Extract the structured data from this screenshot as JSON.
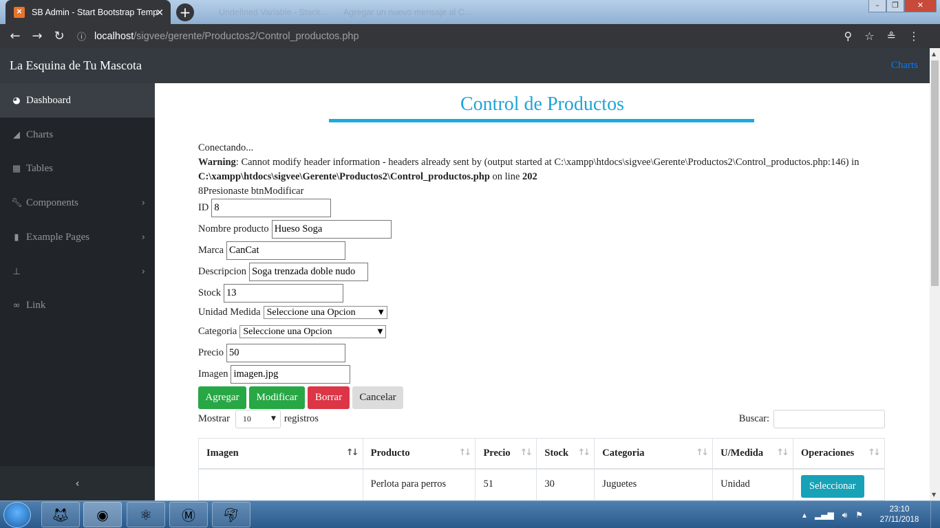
{
  "browser": {
    "active_tab": {
      "title": "SB Admin - Start Bootstrap Temp",
      "favicon": "xampp-favicon-icon"
    },
    "inactive_tabs": [
      {
        "title": "Undefined Variable - Stack..."
      },
      {
        "title": "Agregar un nuevo mensaje al C..."
      }
    ],
    "url_host": "localhost",
    "url_path": "/sigvee/gerente/Productos2/Control_productos.php",
    "icons": [
      "back-icon",
      "forward-icon",
      "reload-icon",
      "info-icon",
      "zoom-icon",
      "star-icon",
      "extension-icon",
      "menu-icon"
    ]
  },
  "navbar": {
    "brand": "La Esquina de Tu Mascota",
    "link": "Charts"
  },
  "sidebar": {
    "items": [
      {
        "label": "Dashboard",
        "icon": "dashboard-icon",
        "active": true
      },
      {
        "label": "Charts",
        "icon": "area-chart-icon"
      },
      {
        "label": "Tables",
        "icon": "table-icon"
      },
      {
        "label": "Components",
        "icon": "wrench-icon",
        "has_children": true
      },
      {
        "label": "Example Pages",
        "icon": "file-icon",
        "has_children": true
      },
      {
        "label": "",
        "icon": "sitemap-icon",
        "has_children": true
      },
      {
        "label": "Link",
        "icon": "link-icon"
      }
    ],
    "toggle": "‹"
  },
  "page": {
    "title": "Control de Productos",
    "connecting": "Conectando...",
    "warning_label": "Warning",
    "warning_text": ": Cannot modify header information - headers already sent by (output started at C:\\xampp\\htdocs\\sigvee\\Gerente\\Productos2\\Control_productos.php:146) in",
    "warning_file": "C:\\xampp\\htdocs\\sigvee\\Gerente\\Productos2\\Control_productos.php",
    "warning_online": " on line ",
    "warning_line": "202",
    "pressed": "8Presionaste btnModificar"
  },
  "form": {
    "id": {
      "label": "ID",
      "value": "8"
    },
    "nombre": {
      "label": "Nombre producto",
      "value": "Hueso Soga"
    },
    "marca": {
      "label": "Marca",
      "value": "CanCat"
    },
    "descripcion": {
      "label": "Descripcion",
      "value": "Soga trenzada doble nudo"
    },
    "stock": {
      "label": "Stock",
      "value": "13"
    },
    "unidad": {
      "label": "Unidad Medida",
      "value": "Seleccione una Opcion"
    },
    "categoria": {
      "label": "Categoria",
      "value": "Seleccione una Opcion"
    },
    "precio": {
      "label": "Precio",
      "value": "50"
    },
    "imagen": {
      "label": "Imagen",
      "value": "imagen.jpg"
    }
  },
  "buttons": {
    "agregar": "Agregar",
    "modificar": "Modificar",
    "borrar": "Borrar",
    "cancelar": "Cancelar"
  },
  "datatable": {
    "show_label": "Mostrar",
    "length": "10",
    "records_label": "registros",
    "search_label": "Buscar:",
    "search_value": "",
    "columns": [
      "Imagen",
      "Producto",
      "Precio",
      "Stock",
      "Categoria",
      "U/Medida",
      "Operaciones"
    ],
    "rows": [
      {
        "imagen": "",
        "producto": "Perlota para perros",
        "precio": "51",
        "stock": "30",
        "categoria": "Juguetes",
        "umedida": "Unidad",
        "action": "Seleccionar"
      }
    ]
  },
  "taskbar": {
    "apps": [
      "firefox-icon",
      "chrome-icon",
      "atom-icon",
      "malwarebytes-icon",
      "mysql-dolphin-icon"
    ],
    "time": "23:10",
    "date": "27/11/2018"
  },
  "colors": {
    "title": "#1fa3d9",
    "navbar": "#343a40",
    "sidebar": "#212529",
    "green": "#28a745",
    "red": "#dc3545",
    "info": "#17a2b8"
  }
}
